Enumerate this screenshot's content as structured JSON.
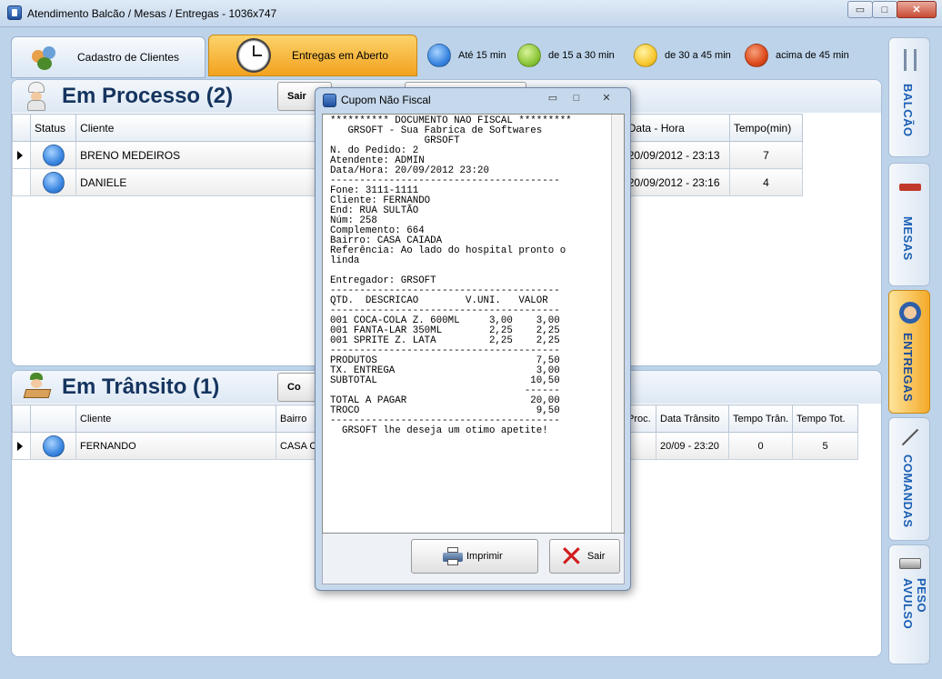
{
  "window": {
    "title": "Atendimento Balcão / Mesas / Entregas - 1036x747",
    "controls": {
      "minimize": "▭",
      "maximize": "□",
      "close": "✕"
    }
  },
  "tabs": {
    "clientes": "Cadastro de Clientes",
    "entregas": "Entregas em Aberto"
  },
  "legend": [
    {
      "label": "Até 15 min",
      "color": "#3a86e0"
    },
    {
      "label": "de 15 a 30 min",
      "color": "#8cc63a"
    },
    {
      "label": "de 30 a 45 min",
      "color": "#f7c830"
    },
    {
      "label": "acima de 45 min",
      "color": "#de4a1c"
    }
  ],
  "processo": {
    "title": "Em Processo (2)",
    "button_sair": "Sair",
    "headers": [
      "Status",
      "Cliente",
      "Data - Hora",
      "Tempo(min)"
    ],
    "rows": [
      {
        "cliente": "BRENO MEDEIROS",
        "datahora": "20/09/2012 - 23:13",
        "tempo": "7"
      },
      {
        "cliente": "DANIELE",
        "datahora": "20/09/2012 - 23:16",
        "tempo": "4"
      }
    ]
  },
  "transito": {
    "title": "Em Trânsito (1)",
    "button_co": "Co",
    "headers": [
      "Cliente",
      "Bairro",
      "Proc.",
      "Data Trânsito",
      "Tempo Trân.",
      "Tempo Tot."
    ],
    "rows": [
      {
        "cliente": "FERNANDO",
        "bairro": "CASA C",
        "datatransito": "20/09 - 23:20",
        "tempotran": "0",
        "tempotot": "5"
      }
    ]
  },
  "side_tabs": [
    "BALCÃO",
    "MESAS",
    "ENTREGAS",
    "COMANDAS",
    "PESO AVULSO"
  ],
  "modal": {
    "title": "Cupom Não Fiscal",
    "controls": {
      "minimize": "▭",
      "maximize": "□",
      "close": "✕"
    },
    "receipt": [
      "********** DOCUMENTO NAO FISCAL *********",
      "   GRSOFT - Sua Fabrica de Softwares",
      "                GRSOFT",
      "N. do Pedido: 2",
      "Atendente: ADMIN",
      "Data/Hora: 20/09/2012 23:20",
      "---------------------------------------",
      "Fone: 3111-1111",
      "Cliente: FERNANDO",
      "End: RUA SULTÃO",
      "Núm: 258",
      "Complemento: 664",
      "Bairro: CASA CAIADA",
      "Referência: Ao lado do hospital pronto o",
      "linda",
      "",
      "Entregador: GRSOFT",
      "---------------------------------------",
      "QTD.  DESCRICAO        V.UNI.   VALOR",
      "---------------------------------------",
      "001 COCA-COLA Z. 600ML     3,00    3,00",
      "001 FANTA-LAR 350ML        2,25    2,25",
      "001 SPRITE Z. LATA         2,25    2,25",
      "---------------------------------------",
      "PRODUTOS                           7,50",
      "TX. ENTREGA                        3,00",
      "SUBTOTAL                          10,50",
      "                                 ------",
      "TOTAL A PAGAR                     20,00",
      "TROCO                              9,50",
      "---------------------------------------",
      "  GRSOFT lhe deseja um otimo apetite!"
    ],
    "button_imprimir": "Imprimir",
    "button_sair": "Sair"
  }
}
